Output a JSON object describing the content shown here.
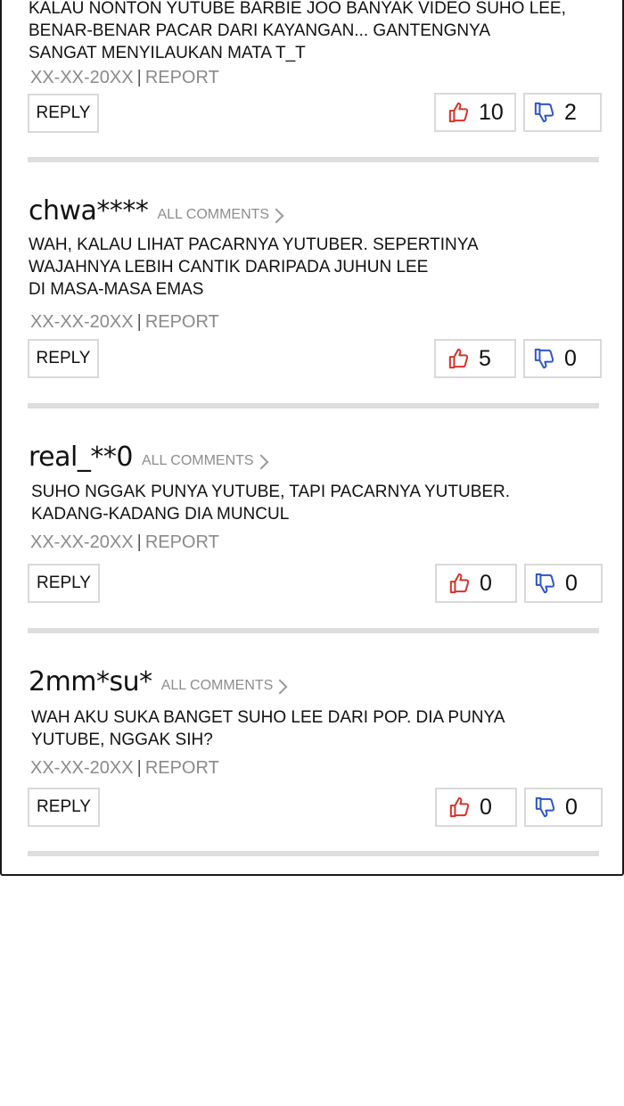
{
  "comments": [
    {
      "username": "",
      "all_comments_label": "",
      "lines": [
        "KALAU NONTON YUTUBE BARBIE JOO BANYAK VIDEO SUHO LEE,",
        "BENAR-BENAR PACAR DARI KAYANGAN... GANTENGNYA",
        "SANGAT MENYILAUKAN MATA T_T"
      ],
      "date": "XX-XX-20XX",
      "report_label": "REPORT",
      "reply_label": "REPLY",
      "likes": "10",
      "dislikes": "2"
    },
    {
      "username": "chwa****",
      "all_comments_label": "ALL COMMENTS",
      "lines": [
        "WAH, KALAU LIHAT PACARNYA YUTUBER. SEPERTINYA",
        "WAJAHNYA LEBIH CANTIK DARIPADA JUHUN LEE",
        "DI MASA-MASA EMAS"
      ],
      "date": "XX-XX-20XX",
      "report_label": "REPORT",
      "reply_label": "REPLY",
      "likes": "5",
      "dislikes": "0"
    },
    {
      "username": "real_**0",
      "all_comments_label": "ALL COMMENTS",
      "lines": [
        "SUHO NGGAK PUNYA YUTUBE, TAPI PACARNYA YUTUBER.",
        "KADANG-KADANG DIA MUNCUL"
      ],
      "date": "XX-XX-20XX",
      "report_label": "REPORT",
      "reply_label": "REPLY",
      "likes": "0",
      "dislikes": "0"
    },
    {
      "username": "2mm*su*",
      "all_comments_label": "ALL COMMENTS",
      "lines": [
        "WAH AKU SUKA BANGET SUHO LEE DARI PoP. DIA PUNYA",
        "YUTUBE, NGGAK SIH?"
      ],
      "date": "XX-XX-20XX",
      "report_label": "REPORT",
      "reply_label": "REPLY",
      "likes": "0",
      "dislikes": "0"
    }
  ],
  "colors": {
    "like_icon": "#d8332a",
    "dislike_icon": "#2f55c8",
    "meta_text": "#8a8a8a",
    "divider": "#dedede",
    "border": "#1a1a1a"
  }
}
